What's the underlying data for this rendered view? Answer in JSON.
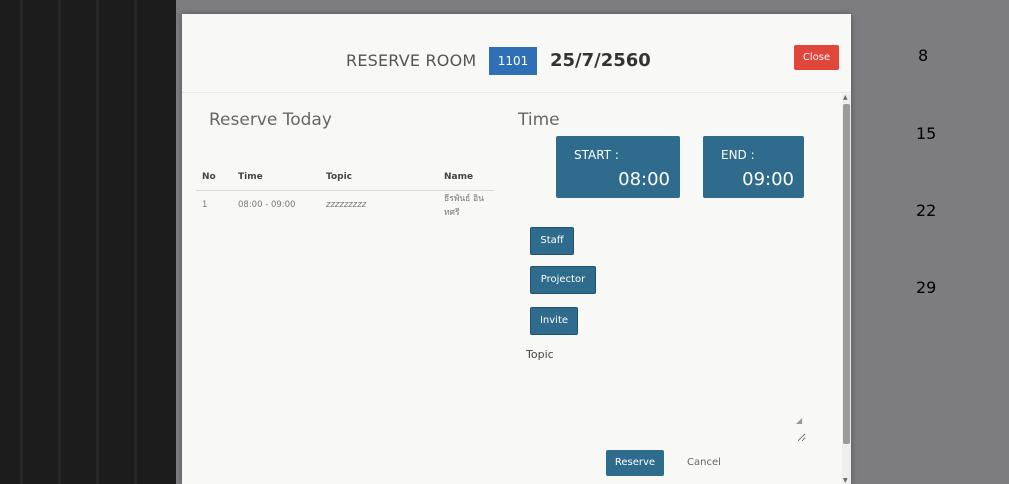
{
  "header": {
    "title": "RESERVE ROOM",
    "room": "1101",
    "date": "25/7/2560",
    "close_label": "Close"
  },
  "reserve_today": {
    "title": "Reserve Today",
    "columns": [
      "No",
      "Time",
      "Topic",
      "Name"
    ],
    "rows": [
      {
        "no": "1",
        "time": "08:00 - 09:00",
        "topic": "zzzzzzzzz",
        "name": "ธีรพันธ์ อินทศรี"
      }
    ]
  },
  "time": {
    "title": "Time",
    "start_label": "START :",
    "start_value": "08:00",
    "end_label": "END :",
    "end_value": "09:00"
  },
  "options": {
    "staff_label": "Staff",
    "projector_label": "Projector",
    "invite_label": "Invite"
  },
  "topic": {
    "label": "Topic",
    "value": ""
  },
  "footer": {
    "reserve_label": "Reserve",
    "cancel_label": "Cancel"
  },
  "background_numbers": [
    "8",
    "15",
    "22",
    "29"
  ],
  "colors": {
    "primary": "#2e6b8c",
    "room_badge": "#2f6fb6",
    "close": "#e0473a"
  }
}
